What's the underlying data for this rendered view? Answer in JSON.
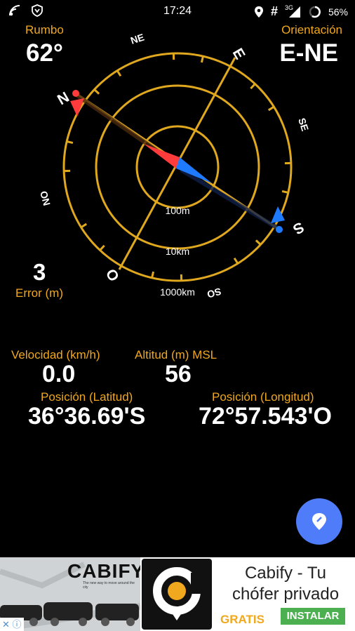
{
  "status": {
    "time": "17:24",
    "network": "3G",
    "battery": "56%",
    "hash": "#"
  },
  "heading": {
    "label": "Rumbo",
    "value": "62°"
  },
  "orientation": {
    "label": "Orientación",
    "value": "E-NE"
  },
  "compass": {
    "dirs": {
      "N": "N",
      "NE": "NE",
      "E": "E",
      "SE": "SE",
      "S": "S",
      "SO": "SO",
      "O": "O",
      "NO": "NO"
    },
    "rings": {
      "r100": "100m",
      "r10k": "10km",
      "r1000k": "1000km"
    }
  },
  "error": {
    "value": "3",
    "label": "Error (m)"
  },
  "speed": {
    "label": "Velocidad (km/h)",
    "value": "0.0"
  },
  "altitude": {
    "label": "Altitud (m) MSL",
    "value": "56"
  },
  "latitude": {
    "label": "Posición (Latitud)",
    "value": "36°36.69'S"
  },
  "longitude": {
    "label": "Posición (Longitud)",
    "value": "72°57.543'O"
  },
  "ad": {
    "brand": "CABIFY",
    "tagline": "The new way to move around the city",
    "title_line1": "Cabify - Tu",
    "title_line2": "chófer privado",
    "gratis": "GRATIS",
    "install": "INSTALAR"
  },
  "colors": {
    "accent": "#f0a81e",
    "red": "#ff3b3b",
    "blue": "#1e7bff",
    "fab": "#4f7df9"
  }
}
